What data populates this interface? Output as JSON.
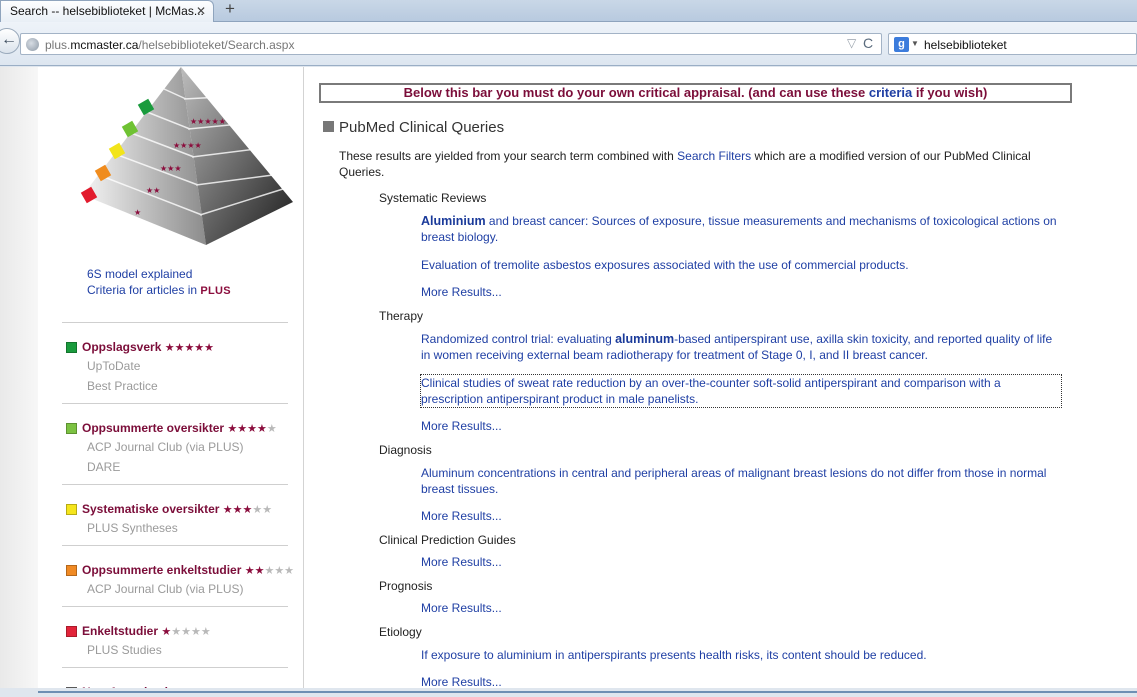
{
  "browser": {
    "tab_title": "Search -- helsebiblioteket | McMas...",
    "tab_close_glyph": "✕",
    "tab_new_glyph": "+",
    "url_prefix": "plus.",
    "url_domain": "mcmaster.ca",
    "url_path": "/helsebiblioteket/Search.aspx",
    "search_engine_glyph": "g",
    "search_text": "helsebiblioteket",
    "back_glyph": "←",
    "reload_glyph": "C",
    "star_glyph": "▽"
  },
  "sidebar": {
    "links": [
      "6S model explained",
      "Criteria for articles in"
    ],
    "plus_logo": "PLUS",
    "pyramid_colors": [
      "#1a9b3d",
      "#6fc233",
      "#f2e41a",
      "#f08c1e",
      "#e21b2d"
    ],
    "categories": [
      {
        "title": "Oppslagsverk",
        "stars_on": "★★★★★",
        "stars_off": "",
        "color": "#1a9b3d",
        "subs": [
          "UpToDate",
          "Best Practice"
        ]
      },
      {
        "title": "Oppsummerte oversikter",
        "stars_on": "★★★★",
        "stars_off": "★",
        "color": "#7cc242",
        "subs": [
          "ACP Journal Club (via PLUS)",
          "DARE"
        ]
      },
      {
        "title": "Systematiske oversikter",
        "stars_on": "★★★",
        "stars_off": "★★",
        "color": "#f5e51c",
        "subs": [
          "PLUS Syntheses"
        ]
      },
      {
        "title": "Oppsummerte enkeltstudier",
        "stars_on": "★★",
        "stars_off": "★★★",
        "color": "#f08a24",
        "subs": [
          "ACP Journal Club (via PLUS)"
        ]
      },
      {
        "title": "Enkeltstudier",
        "stars_on": "★",
        "stars_off": "★★★★",
        "color": "#e2243a",
        "subs": [
          "PLUS Studies"
        ]
      },
      {
        "title": "Non-Appraised",
        "stars_on": "",
        "stars_off": "★★★★★",
        "color": "#777777",
        "subs": []
      }
    ]
  },
  "main": {
    "appraisal_text_a": "Below this bar you must do your own critical appraisal. (and can use these ",
    "appraisal_link": "criteria",
    "appraisal_text_b": " if you wish)",
    "section_title": "PubMed Clinical Queries",
    "intro_a": "These results are yielded from your search term combined with ",
    "intro_link": "Search Filters",
    "intro_b": " which are a modified version of our PubMed Clinical Queries.",
    "more_label": "More Results...",
    "groups": {
      "systematic_reviews": "Systematic Reviews",
      "therapy": "Therapy",
      "diagnosis": "Diagnosis",
      "cpg": "Clinical Prediction Guides",
      "prognosis": "Prognosis",
      "etiology": "Etiology"
    },
    "results": {
      "sr1_bold": "Aluminium",
      "sr1_rest": " and breast cancer: Sources of exposure, tissue measurements and mechanisms of toxicological actions on breast biology.",
      "sr2": "Evaluation of tremolite asbestos exposures associated with the use of commercial products.",
      "th1_a": "Randomized control trial: evaluating ",
      "th1_bold": "aluminum",
      "th1_b": "-based antiperspirant use, axilla skin toxicity, and reported quality of life in women receiving external beam radiotherapy for treatment of Stage 0, I, and II breast cancer.",
      "th2": "Clinical studies of sweat rate reduction by an over-the-counter soft-solid antiperspirant and comparison with a prescription antiperspirant product in male panelists.",
      "dx1": "Aluminum concentrations in central and peripheral areas of malignant breast lesions do not differ from those in normal breast tissues.",
      "et1": "If exposure to aluminium in antiperspirants presents health risks, its content should be reduced."
    }
  }
}
